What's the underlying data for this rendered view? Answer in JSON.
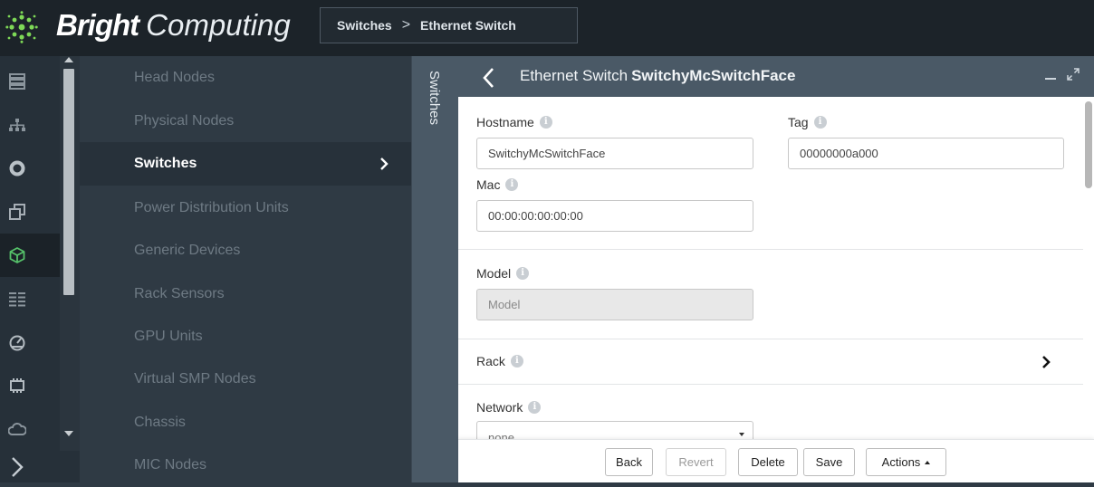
{
  "brand": {
    "bold": "Bright",
    "light": "Computing"
  },
  "breadcrumb": {
    "items": [
      "Switches",
      "Ethernet Switch"
    ],
    "separator": ">"
  },
  "rail": {
    "icons": [
      "server-list-icon",
      "network-tree-icon",
      "disc-icon",
      "copy-squares-icon",
      "cube-icon",
      "columns-list-icon",
      "gauge-icon",
      "chip-icon",
      "cloud-icon"
    ],
    "active_index": 4,
    "active_color": "#56c26a",
    "expand_icon": "chevron-right-icon"
  },
  "menu": {
    "items": [
      "Head Nodes",
      "Physical Nodes",
      "Switches",
      "Power Distribution Units",
      "Generic Devices",
      "Rack Sensors",
      "GPU Units",
      "Virtual SMP Nodes",
      "Chassis",
      "MIC Nodes"
    ],
    "active_index": 2
  },
  "vertical_tab": {
    "label": "Switches"
  },
  "panel": {
    "title_prefix": "Ethernet Switch",
    "title_name": "SwitchyMcSwitchFace",
    "fields": {
      "hostname": {
        "label": "Hostname",
        "value": "SwitchyMcSwitchFace"
      },
      "tag": {
        "label": "Tag",
        "value": "00000000a000"
      },
      "mac": {
        "label": "Mac",
        "value": "00:00:00:00:00:00"
      },
      "model": {
        "label": "Model",
        "placeholder": "Model"
      },
      "rack": {
        "label": "Rack"
      },
      "network": {
        "label": "Network",
        "value": "none"
      }
    },
    "info_glyph": "i"
  },
  "footer": {
    "back": "Back",
    "revert": "Revert",
    "delete": "Delete",
    "save": "Save",
    "actions": "Actions"
  },
  "colors": {
    "topbar": "#1c2329",
    "sidebar": "#2f3a44",
    "panel_header": "#4a5966",
    "logo_green": "#7ed957"
  }
}
